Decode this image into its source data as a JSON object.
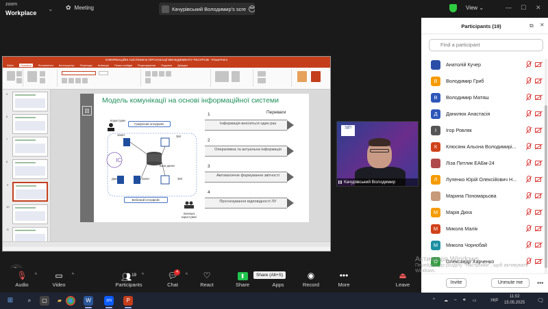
{
  "app": {
    "logo_top": "zoom",
    "logo_bottom": "Workplace",
    "meeting_label": "Meeting",
    "view_label": "View"
  },
  "share_pill": {
    "label": "Качурівський Володимир's scre"
  },
  "ppt": {
    "window_title": "ІНФОРМАЦІЙНІ СИСТЕМИ В ОРГАНІЗАЦІЇ МЕНЕДЖМЕНТУ РЕСУРСІВ - PowerPoint",
    "tabs": [
      "Файл",
      "Основне",
      "Вставлення",
      "Конструктор",
      "Переходи",
      "Анімація",
      "Показ слайдів",
      "Рецензування",
      "Подання",
      "Довідка"
    ],
    "slide_numbers": [
      "5",
      "6",
      "7",
      "8",
      "9",
      "10",
      "11"
    ]
  },
  "slide": {
    "title": "Модель комунікації на основі інформаційної системи",
    "benefits_label": "Переваги",
    "items": [
      {
        "n": "1",
        "text": "Інформація вноситься один раз"
      },
      {
        "n": "2",
        "text": "Оперативна та актуальна інформація"
      },
      {
        "n": "3",
        "text": "Автоматичне формування звітності"
      },
      {
        "n": "4",
        "text": "Прогнозування відповідності ЛУ"
      }
    ],
    "diagram": {
      "ic": "IC",
      "graphic_interface": "Графічний інтерфейс",
      "web_interface": "Вебінний інтерфейс",
      "database": "База даних",
      "user": "Користувач",
      "request1": "Запит",
      "report1": "Звіт",
      "data": "Дані",
      "request2": "Запит",
      "report2": "Звіт",
      "external": "Зовнішні користувачі"
    }
  },
  "video": {
    "name": "Качурівський Володимир",
    "badge": "ЗДП"
  },
  "toolbar": {
    "audio": "Audio",
    "video": "Video",
    "participants": "Participants",
    "participants_count": "19",
    "chat": "Chat",
    "chat_badge": "4",
    "react": "React",
    "share": "Share",
    "apps": "Apps",
    "record": "Record",
    "more": "More",
    "leave": "Leave",
    "share_tooltip": "Share (Alt+S)"
  },
  "panel": {
    "title": "Participants (19)",
    "search_placeholder": "Find a participant",
    "participants": [
      {
        "initial": "",
        "name": "Анатолій Кучер",
        "color": "#2b4fa8"
      },
      {
        "initial": "В",
        "name": "Володимир  Гриб",
        "color": "#f59b00"
      },
      {
        "initial": "В",
        "name": "Володимир Матяш",
        "color": "#2c56b8"
      },
      {
        "initial": "Д",
        "name": "Данилюк Анастасія",
        "color": "#2c56b8"
      },
      {
        "initial": "І",
        "name": "Ігор Ровляк",
        "color": "#555555"
      },
      {
        "initial": "К",
        "name": "Клюсянк Альона Володимирі...",
        "color": "#d0421b"
      },
      {
        "initial": "",
        "name": "Ліза Питлик ЕАБм-24",
        "color": "#b04a4a"
      },
      {
        "initial": "Л",
        "name": "Лупенко Юрій Олексійович Н...",
        "color": "#f59b00"
      },
      {
        "initial": "",
        "name": "Марина Пономарьова",
        "color": "#c79a7a"
      },
      {
        "initial": "М",
        "name": "Марія Диха",
        "color": "#f59b00"
      },
      {
        "initial": "М",
        "name": "Микола Малік",
        "color": "#d0421b"
      },
      {
        "initial": "М",
        "name": "Микола Чорнобай",
        "color": "#1c8fa3"
      },
      {
        "initial": "О",
        "name": "Олександр Харченко",
        "color": "#2e9e3e"
      }
    ],
    "invite": "Invite",
    "unmute_me": "Unmute me"
  },
  "watermark": {
    "line1": "Активація Windows",
    "line2": "Перейдіть до розділу \"Настройки\", щоб активувати Windows."
  },
  "taskbar": {
    "lang": "УКР",
    "time": "11:02",
    "date": "15.05.2025"
  }
}
